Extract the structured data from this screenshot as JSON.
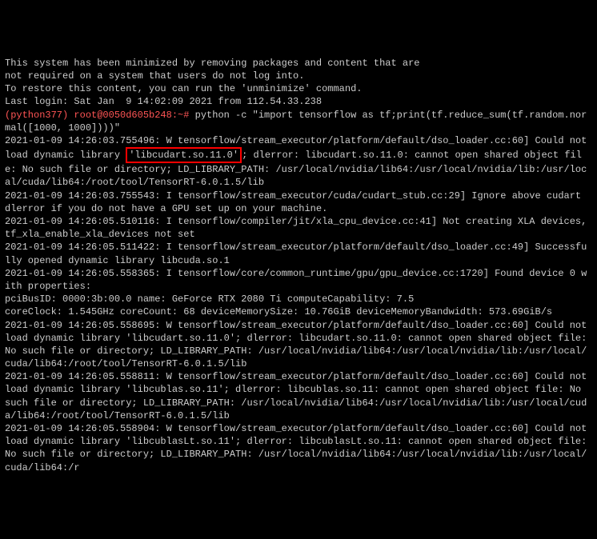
{
  "motd": {
    "line1": "This system has been minimized by removing packages and content that are",
    "line2": "not required on a system that users do not log into.",
    "line3": "",
    "line4": "To restore this content, you can run the 'unminimize' command.",
    "line5": "Last login: Sat Jan  9 14:02:09 2021 from 112.54.33.238"
  },
  "prompt": {
    "user_host": "(python377) root@0050d605b248:~# ",
    "command": "python -c \"import tensorflow as tf;print(tf.reduce_sum(tf.random.normal([1000, 1000])))\""
  },
  "log": {
    "l1a": "2021-01-09 14:26:03.755496: W tensorflow/stream_executor/platform/default/dso_loader.cc:60] Could not load dynamic library ",
    "l1_hl": "'libcudart.so.11.0'",
    "l1b": "; dlerror: libcudart.so.11.0: cannot open shared object file: No such file or directory; LD_LIBRARY_PATH: /usr/local/nvidia/lib64:/usr/local/nvidia/lib:/usr/local/cuda/lib64:/root/tool/TensorRT-6.0.1.5/lib",
    "l2": "2021-01-09 14:26:03.755543: I tensorflow/stream_executor/cuda/cudart_stub.cc:29] Ignore above cudart dlerror if you do not have a GPU set up on your machine.",
    "l3": "2021-01-09 14:26:05.510116: I tensorflow/compiler/jit/xla_cpu_device.cc:41] Not creating XLA devices, tf_xla_enable_xla_devices not set",
    "l4": "2021-01-09 14:26:05.511422: I tensorflow/stream_executor/platform/default/dso_loader.cc:49] Successfully opened dynamic library libcuda.so.1",
    "l5": "2021-01-09 14:26:05.558365: I tensorflow/core/common_runtime/gpu/gpu_device.cc:1720] Found device 0 with properties:",
    "l6": "pciBusID: 0000:3b:00.0 name: GeForce RTX 2080 Ti computeCapability: 7.5",
    "l7": "coreClock: 1.545GHz coreCount: 68 deviceMemorySize: 10.76GiB deviceMemoryBandwidth: 573.69GiB/s",
    "l8": "2021-01-09 14:26:05.558695: W tensorflow/stream_executor/platform/default/dso_loader.cc:60] Could not load dynamic library 'libcudart.so.11.0'; dlerror: libcudart.so.11.0: cannot open shared object file: No such file or directory; LD_LIBRARY_PATH: /usr/local/nvidia/lib64:/usr/local/nvidia/lib:/usr/local/cuda/lib64:/root/tool/TensorRT-6.0.1.5/lib",
    "l9": "2021-01-09 14:26:05.558811: W tensorflow/stream_executor/platform/default/dso_loader.cc:60] Could not load dynamic library 'libcublas.so.11'; dlerror: libcublas.so.11: cannot open shared object file: No such file or directory; LD_LIBRARY_PATH: /usr/local/nvidia/lib64:/usr/local/nvidia/lib:/usr/local/cuda/lib64:/root/tool/TensorRT-6.0.1.5/lib",
    "l10": "2021-01-09 14:26:05.558904: W tensorflow/stream_executor/platform/default/dso_loader.cc:60] Could not load dynamic library 'libcublasLt.so.11'; dlerror: libcublasLt.so.11: cannot open shared object file: No such file or directory; LD_LIBRARY_PATH: /usr/local/nvidia/lib64:/usr/local/nvidia/lib:/usr/local/cuda/lib64:/r"
  }
}
